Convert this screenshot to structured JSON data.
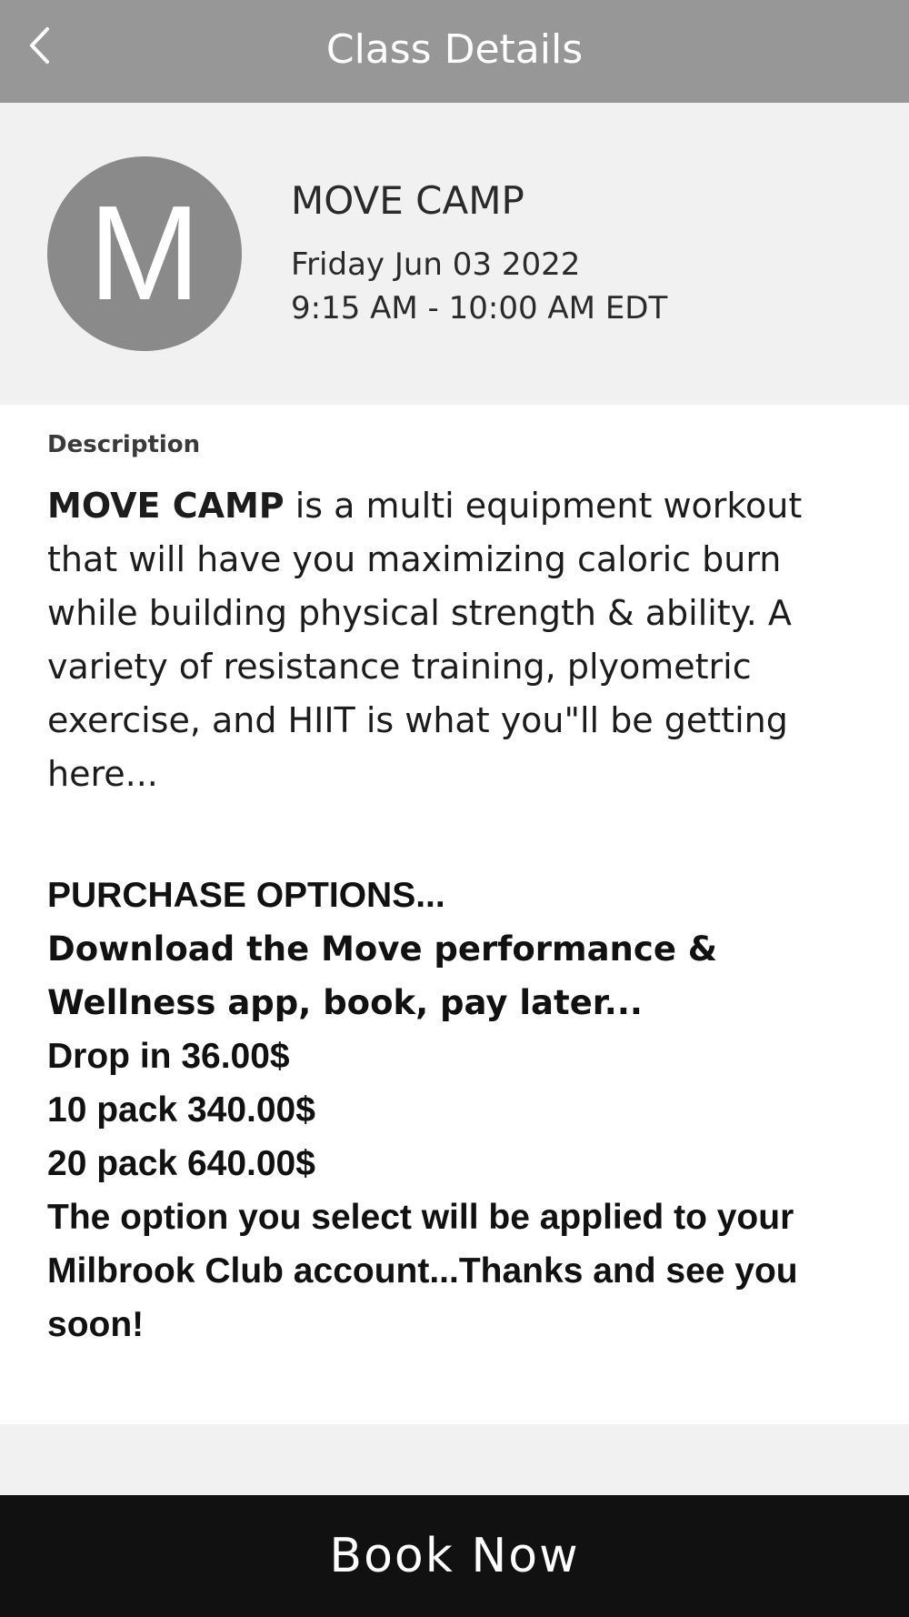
{
  "header": {
    "title": "Class Details",
    "back_icon": "chevron-left-icon"
  },
  "class": {
    "avatar_letter": "M",
    "name": "MOVE CAMP",
    "date": "Friday Jun 03 2022",
    "time": "9:15 AM - 10:00 AM EDT"
  },
  "description": {
    "label": "Description",
    "lead_bold": "MOVE CAMP",
    "lead_rest": " is a multi equipment workout that will have you maximizing caloric burn while building physical strength & ability. A variety of resistance training, plyometric exercise, and HIIT is what you\"ll be getting here..."
  },
  "purchase": {
    "lines": [
      "PURCHASE OPTIONS...",
      "Download the Move performance &",
      "Wellness app, book, pay later...",
      "Drop in 36.00$",
      "10 pack 340.00$",
      "20 pack 640.00$",
      "The option you select will be applied to your",
      "Milbrook Club account...Thanks and see you",
      "soon!"
    ]
  },
  "footer": {
    "book_label": "Book Now"
  },
  "colors": {
    "topbar": "#979797",
    "header_panel": "#f1f1f1",
    "avatar": "#8a8a8a",
    "book_button": "#111111"
  }
}
